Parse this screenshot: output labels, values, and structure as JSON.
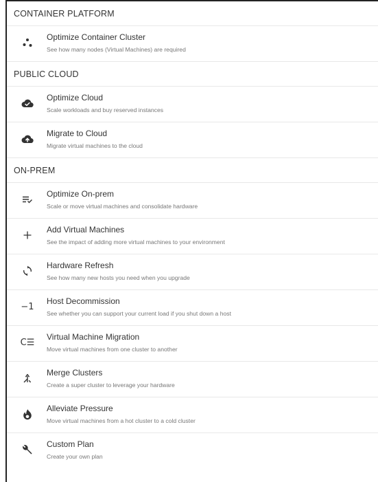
{
  "sections": [
    {
      "title": "CONTAINER PLATFORM",
      "items": [
        {
          "icon": "container-dots-icon",
          "title": "Optimize Container Cluster",
          "description": "See how many nodes (Virtual Machines) are required"
        }
      ]
    },
    {
      "title": "PUBLIC CLOUD",
      "items": [
        {
          "icon": "cloud-check-icon",
          "title": "Optimize Cloud",
          "description": "Scale workloads and buy reserved instances"
        },
        {
          "icon": "cloud-upload-icon",
          "title": "Migrate to Cloud",
          "description": "Migrate virtual machines to the cloud"
        }
      ]
    },
    {
      "title": "ON-PREM",
      "items": [
        {
          "icon": "list-check-icon",
          "title": "Optimize On-prem",
          "description": "Scale or move virtual machines and consolidate hardware"
        },
        {
          "icon": "plus-icon",
          "title": "Add Virtual Machines",
          "description": "See the impact of adding more virtual machines to your environment"
        },
        {
          "icon": "refresh-icon",
          "title": "Hardware Refresh",
          "description": "See how many new hosts you need when you upgrade"
        },
        {
          "icon": "minus-one-icon",
          "title": "Host Decommission",
          "description": "See whether you can support your current load if you shut down a host"
        },
        {
          "icon": "move-list-icon",
          "title": "Virtual Machine Migration",
          "description": "Move virtual machines from one cluster to another"
        },
        {
          "icon": "merge-icon",
          "title": "Merge Clusters",
          "description": "Create a super cluster to leverage your hardware"
        },
        {
          "icon": "flame-icon",
          "title": "Alleviate Pressure",
          "description": "Move virtual machines from a hot cluster to a cold cluster"
        },
        {
          "icon": "wrench-icon",
          "title": "Custom Plan",
          "description": "Create your own plan"
        }
      ]
    }
  ],
  "glyphs": {
    "minus_one": "−1",
    "move_list": "C☰"
  }
}
